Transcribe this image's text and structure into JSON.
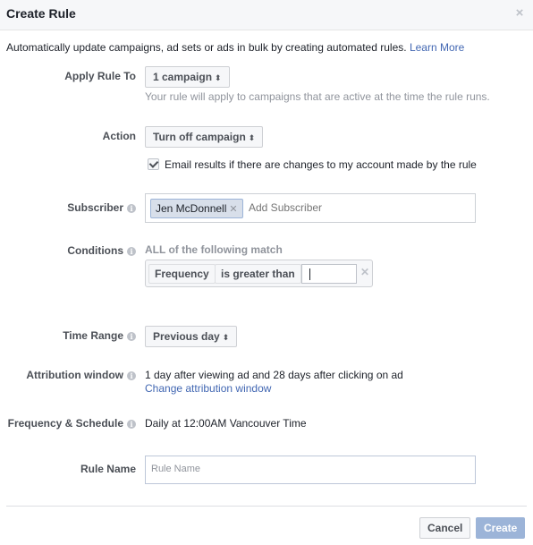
{
  "dialog": {
    "title": "Create Rule",
    "close_icon": "close-icon"
  },
  "intro": {
    "text": "Automatically update campaigns, ad sets or ads in bulk by creating automated rules.",
    "link": "Learn More"
  },
  "apply_rule_to": {
    "label": "Apply Rule To",
    "value": "1 campaign",
    "hint": "Your rule will apply to campaigns that are active at the time the rule runs."
  },
  "action": {
    "label": "Action",
    "value": "Turn off campaign",
    "email_checkbox": {
      "label": "Email results if there are changes to my account made by the rule",
      "checked": true
    }
  },
  "subscriber": {
    "label": "Subscriber",
    "tokens": [
      "Jen McDonnell"
    ],
    "placeholder": "Add Subscriber"
  },
  "conditions": {
    "label": "Conditions",
    "match_text": "ALL of the following match",
    "rows": [
      {
        "metric": "Frequency",
        "operator": "is greater than",
        "value": ""
      }
    ]
  },
  "time_range": {
    "label": "Time Range",
    "value": "Previous day"
  },
  "attribution_window": {
    "label": "Attribution window",
    "value": "1 day after viewing ad and 28 days after clicking on ad",
    "link": "Change attribution window"
  },
  "schedule": {
    "label": "Frequency & Schedule",
    "value": "Daily at 12:00AM Vancouver Time"
  },
  "rule_name": {
    "label": "Rule Name",
    "placeholder": "Rule Name",
    "value": ""
  },
  "footer": {
    "cancel_label": "Cancel",
    "create_label": "Create"
  },
  "icons": {
    "dropdown_arrow": "↕",
    "info": "i",
    "remove": "×"
  },
  "colors": {
    "link": "#4267b2",
    "create_disabled": "#9cb4d8",
    "token_bg": "#d8dfea"
  }
}
